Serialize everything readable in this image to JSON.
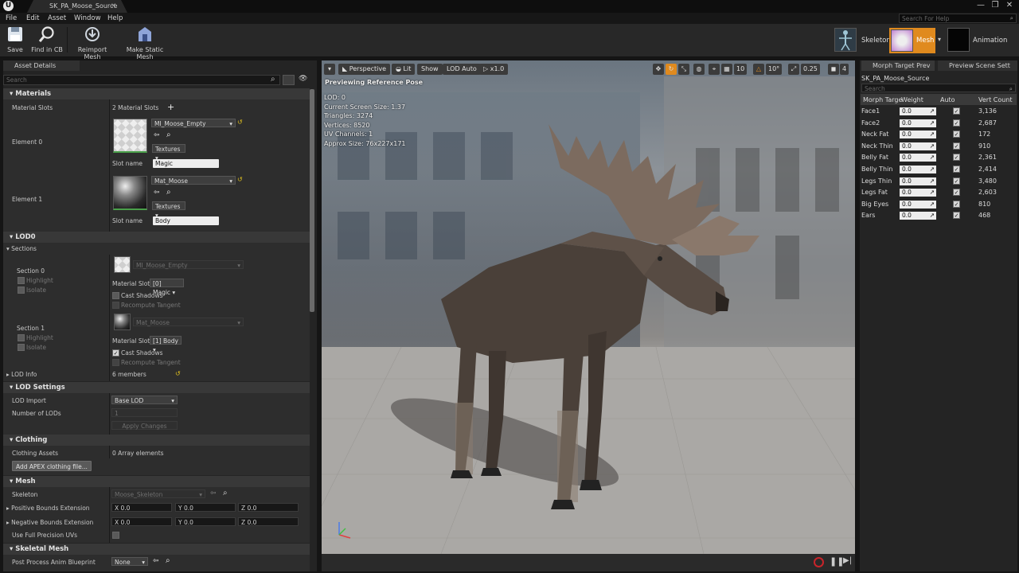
{
  "app": {
    "logo": "U",
    "tab_title": "SK_PA_Moose_Source",
    "tab_close": "×",
    "window_controls": [
      "—",
      "❐",
      "✕"
    ]
  },
  "menu": {
    "items": [
      "File",
      "Edit",
      "Asset",
      "Window",
      "Help"
    ],
    "search_placeholder": "Search For Help"
  },
  "toolbar": {
    "buttons": [
      {
        "label": "Save",
        "icon": "save-icon"
      },
      {
        "label": "Find in CB",
        "icon": "magnifier-icon"
      },
      {
        "label": "Reimport Mesh",
        "icon": "reimport-icon"
      },
      {
        "label": "Make Static Mesh",
        "icon": "static-mesh-icon"
      }
    ],
    "modes": {
      "skeleton": "Skeleton",
      "mesh": "Mesh",
      "animation": "Animation"
    }
  },
  "asset_details": {
    "tab": "Asset Details",
    "search_placeholder": "Search",
    "materials": {
      "heading": "Materials",
      "slots_label": "Material Slots",
      "slots_value": "2 Material Slots",
      "elements": [
        {
          "label": "Element 0",
          "material": "MI_Moose_Empty",
          "textures": "Textures",
          "slot_name_label": "Slot name",
          "slot_name": "Magic"
        },
        {
          "label": "Element 1",
          "material": "Mat_Moose",
          "textures": "Textures",
          "slot_name_label": "Slot name",
          "slot_name": "Body"
        }
      ]
    },
    "lod0": {
      "heading": "LOD0",
      "sections_label": "Sections",
      "sections": [
        {
          "label": "Section 0",
          "highlight": "Highlight",
          "isolate": "Isolate",
          "material": "MI_Moose_Empty",
          "material_slot_label": "Material Slot",
          "material_slot": "[0] Magic",
          "cast_shadows": "Cast Shadows",
          "recompute_tangent": "Recompute Tangent"
        },
        {
          "label": "Section 1",
          "highlight": "Highlight",
          "isolate": "Isolate",
          "material": "Mat_Moose",
          "material_slot_label": "Material Slot",
          "material_slot": "[1] Body",
          "cast_shadows": "Cast Shadows",
          "recompute_tangent": "Recompute Tangent"
        }
      ],
      "lod_info_label": "LOD Info",
      "lod_info_value": "6 members"
    },
    "lod_settings": {
      "heading": "LOD Settings",
      "lod_import_label": "LOD Import",
      "lod_import_value": "Base LOD",
      "num_lods_label": "Number of LODs",
      "num_lods_value": "1",
      "apply_changes": "Apply Changes"
    },
    "clothing": {
      "heading": "Clothing",
      "assets_label": "Clothing Assets",
      "assets_value": "0 Array elements",
      "add_button": "Add APEX clothing file..."
    },
    "mesh": {
      "heading": "Mesh",
      "skeleton_label": "Skeleton",
      "skeleton_value": "Moose_Skeleton",
      "pos_bounds_label": "Positive Bounds Extension",
      "neg_bounds_label": "Negative Bounds Extension",
      "axes": [
        "X",
        "Y",
        "Z"
      ],
      "bound_value": "0.0",
      "full_precision_label": "Use Full Precision UVs"
    },
    "skeletal_mesh": {
      "heading": "Skeletal Mesh",
      "post_process_label": "Post Process Anim Blueprint",
      "post_process_value": "None"
    }
  },
  "viewport": {
    "toolbar": {
      "perspective": "Perspective",
      "lit": "Lit",
      "show": "Show",
      "lod": "LOD Auto",
      "speed": "x1.0",
      "grid_snap": "10",
      "rot_snap": "10°",
      "scale_snap": "0.25",
      "cam_speed": "4"
    },
    "preview_label": "Previewing Reference Pose",
    "stats": [
      "LOD: 0",
      "Current Screen Size: 1.37",
      "Triangles: 3274",
      "Vertices: 8520",
      "UV Channels: 1",
      "Approx Size: 76x227x171"
    ]
  },
  "morph_panel": {
    "tabs": [
      "Morph Target Prev",
      "Preview Scene Sett"
    ],
    "asset_name": "SK_PA_Moose_Source",
    "search_placeholder": "Search",
    "columns": [
      "Morph Targe",
      "Weight",
      "Auto",
      "Vert Count"
    ],
    "rows": [
      {
        "name": "Face1",
        "weight": "0.0",
        "count": "3,136"
      },
      {
        "name": "Face2",
        "weight": "0.0",
        "count": "2,687"
      },
      {
        "name": "Neck Fat",
        "weight": "0.0",
        "count": "172"
      },
      {
        "name": "Neck Thin",
        "weight": "0.0",
        "count": "910"
      },
      {
        "name": "Belly Fat",
        "weight": "0.0",
        "count": "2,361"
      },
      {
        "name": "Belly Thin",
        "weight": "0.0",
        "count": "2,414"
      },
      {
        "name": "Legs Thin",
        "weight": "0.0",
        "count": "3,480"
      },
      {
        "name": "Legs Fat",
        "weight": "0.0",
        "count": "2,603"
      },
      {
        "name": "Big Eyes",
        "weight": "0.0",
        "count": "810"
      },
      {
        "name": "Ears",
        "weight": "0.0",
        "count": "468"
      }
    ]
  },
  "colors": {
    "accent_orange": "#e08a1e",
    "record_red": "#c8242a",
    "panel_bg": "#242424"
  }
}
